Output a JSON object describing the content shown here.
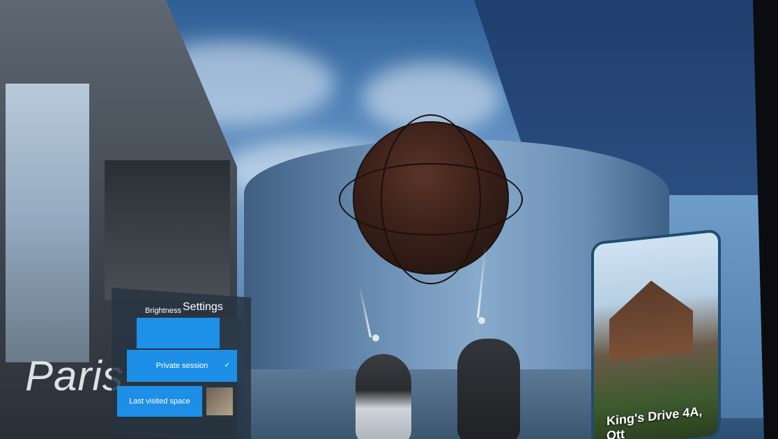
{
  "room": {
    "title": "Paris"
  },
  "settings": {
    "title": "Settings",
    "brightness_label": "Brightness",
    "brightness_value": 0.78,
    "private_session_label": "Private session",
    "last_visited_label": "Last visited space"
  },
  "property_card": {
    "title": "King's Drive 4A, Ott"
  },
  "colors": {
    "accent": "#1e8fe6",
    "card_border": "#1f4d72"
  },
  "icons": {
    "check": "check-icon"
  }
}
